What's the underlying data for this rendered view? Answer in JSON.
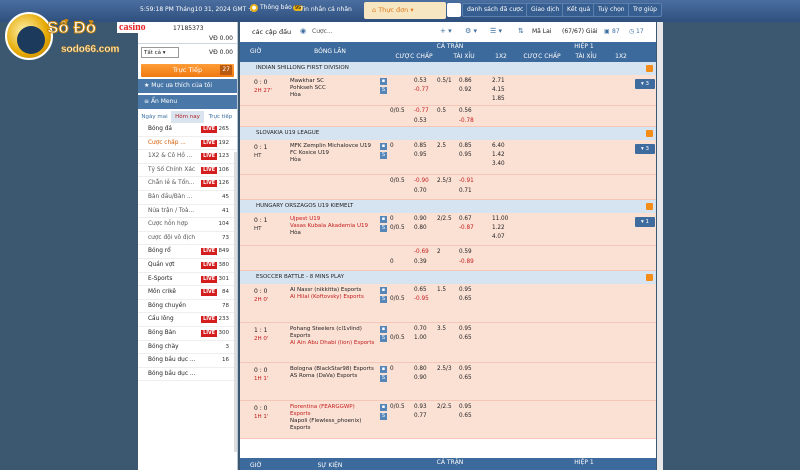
{
  "topbar": {
    "time": "5:59:18 PM Tháng10 31, 2024 GMT +8",
    "notice": "Thông báo",
    "notice_badge": "99",
    "link1": "Tin nhắn cá nhân",
    "menu": "Thực đơn",
    "buttons": [
      "danh sách đã cược",
      "Giao dịch",
      "Kết quả",
      "Tuỳ chọn",
      "Trợ giúp"
    ]
  },
  "logo": {
    "name": "Sổ Đỏ",
    "casino": "casino",
    "url": "sodo66.com"
  },
  "account": {
    "uid": "17185373",
    "vd": "VĐ 0.00",
    "lbl": "Tài khoản"
  },
  "sidebar": {
    "select": "Tất cả",
    "vd": "VĐ 0.00",
    "live_label": "Trực Tiếp",
    "live_count": "27",
    "fav": "Mục ưa thích của tôi",
    "menu": "Ẩn Menu",
    "header_top": "Đóng tất cả thông báo",
    "tabs": [
      "Ngày mai",
      "Hôm nay",
      "Trực tiếp"
    ],
    "sports": [
      {
        "name": "Bóng đá",
        "live": true,
        "n": "265",
        "sub": false
      },
      {
        "name": "Cược chấp ...",
        "live": true,
        "n": "192",
        "sub": true,
        "hl": true
      },
      {
        "name": "1X2 & Cô Hồ ...",
        "live": true,
        "n": "123",
        "sub": true
      },
      {
        "name": "Tỷ Số Chính Xác",
        "live": true,
        "n": "106",
        "sub": true
      },
      {
        "name": "Chẵn lẻ & Tổn...",
        "live": true,
        "n": "126",
        "sub": true
      },
      {
        "name": "Bàn đầu/Bàn ...",
        "live": false,
        "n": "45",
        "sub": true
      },
      {
        "name": "Nửa trận / Toà...",
        "live": false,
        "n": "41",
        "sub": true
      },
      {
        "name": "Cược hỗn hợp",
        "live": false,
        "n": "104",
        "sub": true
      },
      {
        "name": "cược đội vô địch",
        "live": false,
        "n": "73",
        "sub": true
      },
      {
        "name": "Bóng rổ",
        "live": true,
        "n": "849",
        "sub": false
      },
      {
        "name": "Quần vợt",
        "live": true,
        "n": "380",
        "sub": false
      },
      {
        "name": "E-Sports",
        "live": true,
        "n": "301",
        "sub": false
      },
      {
        "name": "Môn crikê",
        "live": true,
        "n": "84",
        "sub": false
      },
      {
        "name": "Bóng chuyền",
        "live": false,
        "n": "78",
        "sub": false
      },
      {
        "name": "Cầu lông",
        "live": true,
        "n": "233",
        "sub": false
      },
      {
        "name": "Bóng Bàn",
        "live": true,
        "n": "300",
        "sub": false
      },
      {
        "name": "Bóng chày",
        "live": false,
        "n": "3",
        "sub": false
      },
      {
        "name": "Bóng bầu dục ...",
        "live": false,
        "n": "16",
        "sub": false
      },
      {
        "name": "Bóng bầu dục ...",
        "live": false,
        "n": "",
        "sub": false
      }
    ]
  },
  "main": {
    "title": "các cập đấu",
    "filter": "Cược...",
    "sort": "Mã Lai",
    "pages": "(67/67) Giải",
    "c87": "87",
    "c17": "17",
    "col": {
      "gio": "GIỜ",
      "bong_lan": "BÓNG LĂN",
      "ca_tran": "CẢ TRẬN",
      "hiep1": "HIỆP 1",
      "cuoc_chap": "CƯỢC CHẤP",
      "tai_xiu": "TÀI XỈU",
      "x12": "1X2",
      "su_kien": "SỰ KIỆN"
    },
    "leagues": [
      {
        "name": "INDIAN SHILLONG FIRST DIVISION",
        "matches": [
          {
            "score": "0 : 0",
            "time": "2H 27'",
            "home": "Mawkhar SC",
            "away": "Pohkseh SCC",
            "draw": "Hòa",
            "btn": "▾ 3",
            "rows": [
              [
                "",
                "0.53",
                "0.5/1",
                "0.86",
                "2.71"
              ],
              [
                "",
                "-0.77",
                "",
                "0.92",
                "4.15"
              ],
              [
                "",
                "",
                "",
                "",
                "1.85"
              ]
            ],
            "rows2": [
              [
                "0/0.5",
                "-0.77",
                "0.5",
                "0.56"
              ],
              [
                "",
                "0.53",
                "",
                "-0.78"
              ]
            ]
          }
        ]
      },
      {
        "name": "SLOVAKIA U19 LEAGUE",
        "matches": [
          {
            "score": "0 : 1",
            "time": "HT",
            "home": "MFK Zemplin Michalovce U19",
            "away": "FC Kosice U19",
            "draw": "Hòa",
            "btn": "▾ 3",
            "rows": [
              [
                "0",
                "0.85",
                "2.5",
                "0.85",
                "6.40"
              ],
              [
                "",
                "0.95",
                "",
                "0.95",
                "1.42"
              ],
              [
                "",
                "",
                "",
                "",
                "3.40"
              ]
            ],
            "rows2": [
              [
                "0/0.5",
                "-0.90",
                "2.5/3",
                "-0.91"
              ],
              [
                "",
                "0.70",
                "",
                "0.71"
              ]
            ]
          }
        ]
      },
      {
        "name": "HUNGARY ORSZAGOS U19 KIEMELT",
        "matches": [
          {
            "score": "0 : 1",
            "time": "HT",
            "home": "Ujpest U19",
            "away": "Vasas Kubala Akademia U19",
            "draw": "Hòa",
            "btn": "▾ 1",
            "rows": [
              [
                "0",
                "0.90",
                "2/2.5",
                "0.67",
                "11.00"
              ],
              [
                "0/0.5",
                "0.80",
                "",
                "-0.87",
                "1.22"
              ],
              [
                "",
                "",
                "",
                "",
                "4.07"
              ]
            ],
            "rows2": [
              [
                "",
                "-0.69",
                "2",
                "0.59"
              ],
              [
                "0",
                "0.39",
                "",
                "-0.89"
              ]
            ]
          }
        ]
      },
      {
        "name": "ESOCCER BATTLE - 8 MINS PLAY",
        "matches": [
          {
            "score": "0 : 0",
            "time": "2H 0'",
            "home": "Al Nassr (nikkitta) Esports",
            "away": "Al Hilal (Koftovsky) Esports",
            "rows": [
              [
                "",
                "0.65",
                "1.5",
                "0.95"
              ],
              [
                "0/0.5",
                "-0.95",
                "",
                "0.65"
              ]
            ]
          },
          {
            "score": "1 : 1",
            "time": "2H 0'",
            "home": "Pohang Steelers (cl1vlind) Esports",
            "away": "Al Ain Abu Dhabi (lion) Esports",
            "rows": [
              [
                "",
                "0.70",
                "3.5",
                "0.95"
              ],
              [
                "0/0.5",
                "1.00",
                "",
                "0.65"
              ]
            ]
          },
          {
            "score": "0 : 0",
            "time": "1H 1'",
            "home": "Bologna (BlackStar98) Esports",
            "away": "AS Roma (DaVa) Esports",
            "rows": [
              [
                "0",
                "0.80",
                "2.5/3",
                "0.95"
              ],
              [
                "",
                "0.90",
                "",
                "0.65"
              ]
            ]
          },
          {
            "score": "0 : 0",
            "time": "1H 1'",
            "home": "Fiorentina (FEARGGWP) Esports",
            "away": "Napoli (Flewless_phoenix) Esports",
            "rows": [
              [
                "0/0.5",
                "0.93",
                "2/2.5",
                "0.95"
              ],
              [
                "",
                "0.77",
                "",
                "0.65"
              ]
            ]
          }
        ]
      }
    ]
  },
  "colors": {
    "header": "#3d6a9c",
    "league": "#d6e4f2",
    "row": "#fbe0d4",
    "live": "#d41e1e",
    "orange": "#f07810"
  }
}
